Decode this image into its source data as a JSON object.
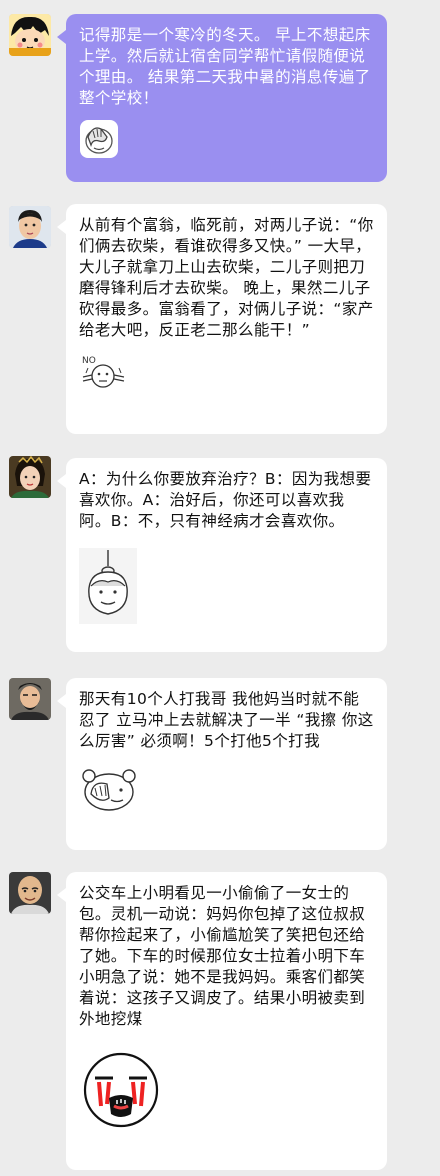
{
  "chat": {
    "messages": [
      {
        "avatar": "cartoon-girl-avatar",
        "text": "记得那是一个寒冷的冬天。 早上不想起床上学。然后就让宿舍同学帮忙请假随便说个理由。 结果第二天我中暑的消息传遍了整个学校！",
        "sticker": "face-palm-sticker",
        "bubble_color": "#9a8ff0"
      },
      {
        "avatar": "young-man-avatar",
        "text": "从前有个富翁，临死前，对两儿子说：“你们俩去砍柴，看谁砍得多又快。” 一大早，大儿子就拿刀上山去砍柴，二儿子则把刀磨得锋利后才去砍柴。 晚上，果然二儿子砍得最多。富翁看了，对俩儿子说：“家产给老大吧，反正老二那么能干！”",
        "sticker": "no-sign-sticker",
        "sticker_text": "NO",
        "bubble_color": "#ffffff"
      },
      {
        "avatar": "costume-woman-avatar",
        "text": "A：为什么你要放弃治疗？B：因为我想要喜欢你。A：治好后，你还可以喜欢我阿。B：不，只有神经病才会喜欢你。",
        "sticker": "hanging-face-sticker",
        "bubble_color": "#ffffff"
      },
      {
        "avatar": "bearded-man-avatar",
        "text": "那天有10个人打我哥 我他妈当时就不能忍了 立马冲上去就解决了一半 “我擦 你这么厉害” 必须啊！5个打他5个打我",
        "sticker": "covering-face-sticker",
        "bubble_color": "#ffffff"
      },
      {
        "avatar": "bald-man-avatar",
        "text": "公交车上小明看见一小偷偷了一女士的包。灵机一动说：妈妈你包掉了这位叔叔帮你捡起来了，小偷尴尬笑了笑把包还给了她。下车的时候那位女士拉着小明下车小明急了说：她不是我妈妈。乘客们都笑着说：这孩子又调皮了。结果小明被卖到外地挖煤",
        "sticker": "crying-face-sticker",
        "bubble_color": "#ffffff"
      }
    ]
  }
}
